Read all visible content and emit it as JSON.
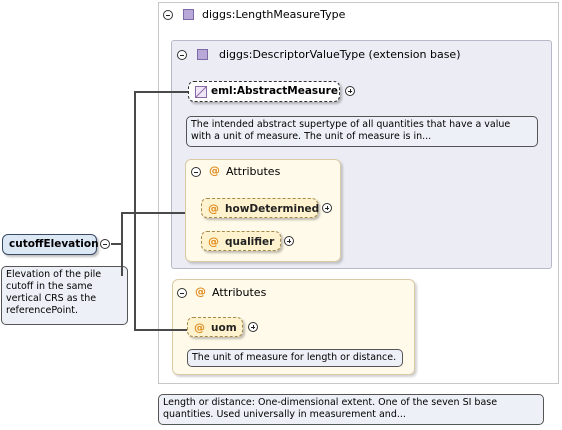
{
  "root": {
    "name": "cutoffElevation",
    "doc": "Elevation of the pile cutoff in the same vertical CRS as the referencePoint."
  },
  "type_panel": {
    "title": "diggs:LengthMeasureType",
    "doc": "Length or distance: One-dimensional extent. One of the seven SI base quantities. Used universally in measurement and..."
  },
  "base_panel": {
    "title": "diggs:DescriptorValueType (extension base)",
    "abstract_element": {
      "name": "eml:AbstractMeasure",
      "doc": "The intended abstract supertype of all quantities that have a value with a unit of measure. The unit of measure is in..."
    },
    "attributes": {
      "title": "Attributes",
      "items": [
        {
          "name": "howDetermined"
        },
        {
          "name": "qualifier"
        }
      ]
    }
  },
  "type_attributes": {
    "title": "Attributes",
    "items": [
      {
        "name": "uom",
        "doc": "The unit of measure for length or distance."
      }
    ]
  },
  "colors": {
    "element_fill": "#dde8f5",
    "attribute_fill": "#fff3cf",
    "attributes_panel": "#fffaea",
    "base_panel": "#ececf4",
    "type_icon": "#b7a8d8",
    "attribute_at": "#e08a1c"
  }
}
